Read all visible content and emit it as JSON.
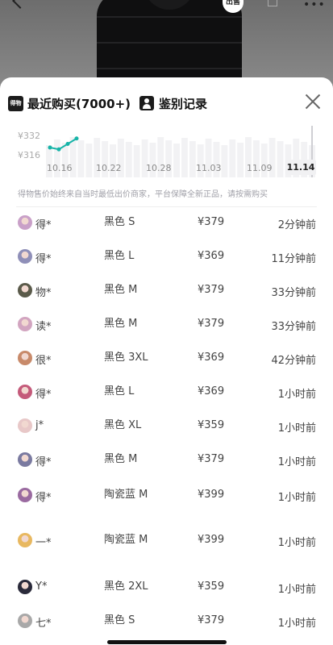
{
  "nav": {
    "badge": "出售"
  },
  "tabs": {
    "recent_logo": "得物",
    "recent_label": "最近购买(7000+)",
    "auth_label": "鉴别记录"
  },
  "chart_data": {
    "type": "line",
    "y_ticks": [
      "¥332",
      "¥316"
    ],
    "x_ticks": [
      "10.16",
      "10.22",
      "10.28",
      "11.03",
      "11.09",
      "11.14"
    ],
    "active_x": "11.14",
    "series": [
      {
        "values": [
          328,
          327,
          330,
          333
        ]
      }
    ],
    "accent": "#17b4a8"
  },
  "disclaimer": "得物售价始终来自当时最低出价商家，平台保障全新正品，请按需购买",
  "records": [
    {
      "buyer": "得*",
      "spec": "黑色 S",
      "price": "¥379",
      "time": "2分钟前"
    },
    {
      "buyer": "得*",
      "spec": "黑色 L",
      "price": "¥369",
      "time": "11分钟前"
    },
    {
      "buyer": "物*",
      "spec": "黑色 M",
      "price": "¥379",
      "time": "33分钟前"
    },
    {
      "buyer": "读*",
      "spec": "黑色 M",
      "price": "¥379",
      "time": "33分钟前"
    },
    {
      "buyer": "很*",
      "spec": "黑色 3XL",
      "price": "¥369",
      "time": "42分钟前"
    },
    {
      "buyer": "得*",
      "spec": "黑色 L",
      "price": "¥369",
      "time": "1小时前"
    },
    {
      "buyer": "j*",
      "spec": "黑色 XL",
      "price": "¥359",
      "time": "1小时前"
    },
    {
      "buyer": "得*",
      "spec": "黑色 M",
      "price": "¥379",
      "time": "1小时前"
    },
    {
      "buyer": "得*",
      "spec": "陶瓷蓝 M",
      "price": "¥399",
      "time": "1小时前"
    },
    {
      "buyer": "一*",
      "spec": "陶瓷蓝 M",
      "price": "¥399",
      "time": "1小时前"
    },
    {
      "buyer": "Y*",
      "spec": "黑色 2XL",
      "price": "¥359",
      "time": "1小时前"
    },
    {
      "buyer": "七*",
      "spec": "黑色 S",
      "price": "¥379",
      "time": "1小时前"
    }
  ],
  "avatar_colors": [
    "#c9a0c8",
    "#8f8fb8",
    "#5a5a4a",
    "#d2a5c0",
    "#c88a6a",
    "#c45a7a",
    "#e8c8c8",
    "#7a7aa0",
    "#9a6aa0",
    "#e8b860",
    "#2a2a3a",
    "#a8a8a8"
  ]
}
